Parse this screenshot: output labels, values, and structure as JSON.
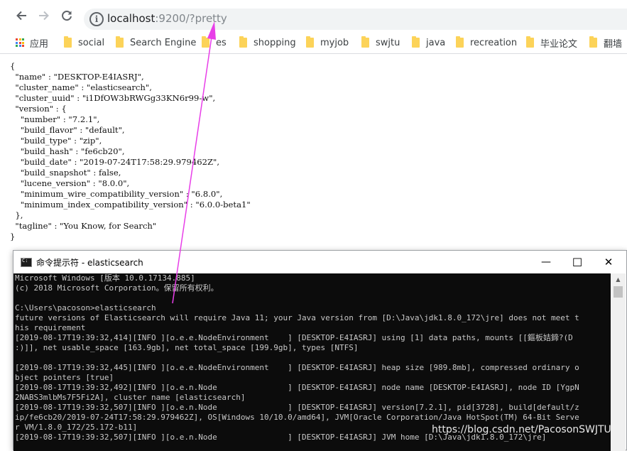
{
  "browser": {
    "url_host": "localhost",
    "url_rest": ":9200/?pretty",
    "icons": [
      "back-arrow-icon",
      "forward-arrow-icon",
      "reload-icon",
      "info-icon"
    ]
  },
  "bookmarks": [
    {
      "label": "应用",
      "icon": "apps-icon"
    },
    {
      "label": "social",
      "icon": "folder-icon"
    },
    {
      "label": "Search Engine",
      "icon": "folder-icon"
    },
    {
      "label": "es",
      "icon": "folder-icon"
    },
    {
      "label": "shopping",
      "icon": "folder-icon"
    },
    {
      "label": "myjob",
      "icon": "folder-icon"
    },
    {
      "label": "swjtu",
      "icon": "folder-icon"
    },
    {
      "label": "java",
      "icon": "folder-icon"
    },
    {
      "label": "recreation",
      "icon": "folder-icon"
    },
    {
      "label": "毕业论文",
      "icon": "folder-icon"
    },
    {
      "label": "翻墙",
      "icon": "folder-icon"
    }
  ],
  "json_response": "{\n  \"name\" : \"DESKTOP-E4IASRJ\",\n  \"cluster_name\" : \"elasticsearch\",\n  \"cluster_uuid\" : \"i1DfOW3bRWGg33KN6r99-w\",\n  \"version\" : {\n    \"number\" : \"7.2.1\",\n    \"build_flavor\" : \"default\",\n    \"build_type\" : \"zip\",\n    \"build_hash\" : \"fe6cb20\",\n    \"build_date\" : \"2019-07-24T17:58:29.979462Z\",\n    \"build_snapshot\" : false,\n    \"lucene_version\" : \"8.0.0\",\n    \"minimum_wire_compatibility_version\" : \"6.8.0\",\n    \"minimum_index_compatibility_version\" : \"6.0.0-beta1\"\n  },\n  \"tagline\" : \"You Know, for Search\"\n}",
  "cmd_window": {
    "title": "命令提示符 - elasticsearch",
    "buttons": {
      "minimize": "—",
      "maximize": "☐",
      "close": "✕"
    },
    "output": "Microsoft Windows [版本 10.0.17134.885]\n(c) 2018 Microsoft Corporation。保留所有权利。\n\nC:\\Users\\pacoson>elasticsearch\nfuture versions of Elasticsearch will require Java 11; your Java version from [D:\\Java\\jdk1.8.0_172\\jre] does not meet t\nhis requirement\n[2019-08-17T19:39:32,414][INFO ][o.e.e.NodeEnvironment    ] [DESKTOP-E4IASRJ] using [1] data paths, mounts [[鏂板姞鍗?(D\n:)]], net usable_space [163.9gb], net total_space [199.9gb], types [NTFS]\n\n[2019-08-17T19:39:32,445][INFO ][o.e.e.NodeEnvironment    ] [DESKTOP-E4IASRJ] heap size [989.8mb], compressed ordinary o\nbject pointers [true]\n[2019-08-17T19:39:32,492][INFO ][o.e.n.Node               ] [DESKTOP-E4IASRJ] node name [DESKTOP-E4IASRJ], node ID [YgpN\n2NABS3mlbMs7F5Fi2A], cluster name [elasticsearch]\n[2019-08-17T19:39:32,507][INFO ][o.e.n.Node               ] [DESKTOP-E4IASRJ] version[7.2.1], pid[3728], build[default/z\nip/fe6cb20/2019-07-24T17:58:29.979462Z], OS[Windows 10/10.0/amd64], JVM[Oracle Corporation/Java HotSpot(TM) 64-Bit Serve\nr VM/1.8.0_172/25.172-b11]\n[2019-08-17T19:39:32,507][INFO ][o.e.n.Node               ] [DESKTOP-E4IASRJ] JVM home [D:\\Java\\jdk1.8.0_172\\jre]"
  },
  "watermark": "https://blog.csdn.net/PacosonSWJTU",
  "colors": {
    "arrow": "#e83ee8",
    "terminal_bg": "#0c0c0c",
    "terminal_fg": "#c8c8c8",
    "folder": "#fcd359"
  }
}
